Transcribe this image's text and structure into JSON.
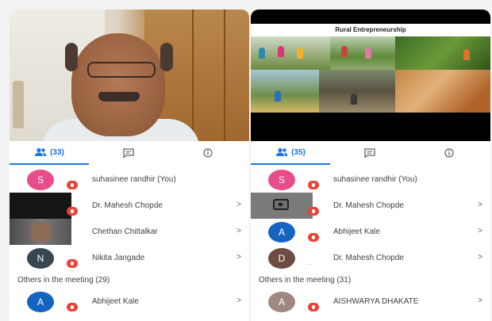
{
  "left": {
    "tabs": {
      "people_count": "(33)"
    },
    "participants": [
      {
        "initial": "S",
        "name": "suhasinee randhir (You)",
        "avatar_color": "#e84c89",
        "status": "muted"
      },
      {
        "initial": "",
        "name": "Dr. Mahesh Chopde",
        "avatar_color": "#151515",
        "status": "muted"
      },
      {
        "initial": "",
        "name": "Chethan Chittalkar",
        "avatar_color": "#6b6b6b",
        "status": "speaking"
      },
      {
        "initial": "N",
        "name": "Nikita Jangade",
        "avatar_color": "#37474f",
        "status": "muted"
      }
    ],
    "others_label": "Others in the meeting (29)",
    "others": [
      {
        "initial": "A",
        "name": "Abhijeet Kale",
        "avatar_color": "#1565c0",
        "status": "muted"
      }
    ]
  },
  "right": {
    "slide_title": "Rural Entrepreneurship",
    "tabs": {
      "people_count": "(35)"
    },
    "participants": [
      {
        "initial": "S",
        "name": "suhasinee randhir (You)",
        "avatar_color": "#e84c89",
        "status": "muted"
      },
      {
        "initial": "",
        "name": "Dr. Mahesh Chopde",
        "avatar_color": "#7a7a7a",
        "status": "muted"
      },
      {
        "initial": "A",
        "name": "Abhijeet Kale",
        "avatar_color": "#1565c0",
        "status": "muted"
      },
      {
        "initial": "D",
        "name": "Dr. Mahesh Chopde",
        "avatar_color": "#6d4c41",
        "status": "speaking"
      }
    ],
    "others_label": "Others in the meeting (31)",
    "others": [
      {
        "initial": "A",
        "name": "AISHWARYA DHAKATE",
        "avatar_color": "#a1887f",
        "status": "muted"
      }
    ]
  },
  "chevron": ">",
  "speaking_indicator": "...",
  "icons": [
    "people-icon",
    "chat-icon",
    "info-icon",
    "mic-off-icon",
    "present-screen-icon"
  ],
  "colors": {
    "accent": "#1a73e8",
    "muted_badge": "#ea4335",
    "speaking": "#34a853"
  }
}
